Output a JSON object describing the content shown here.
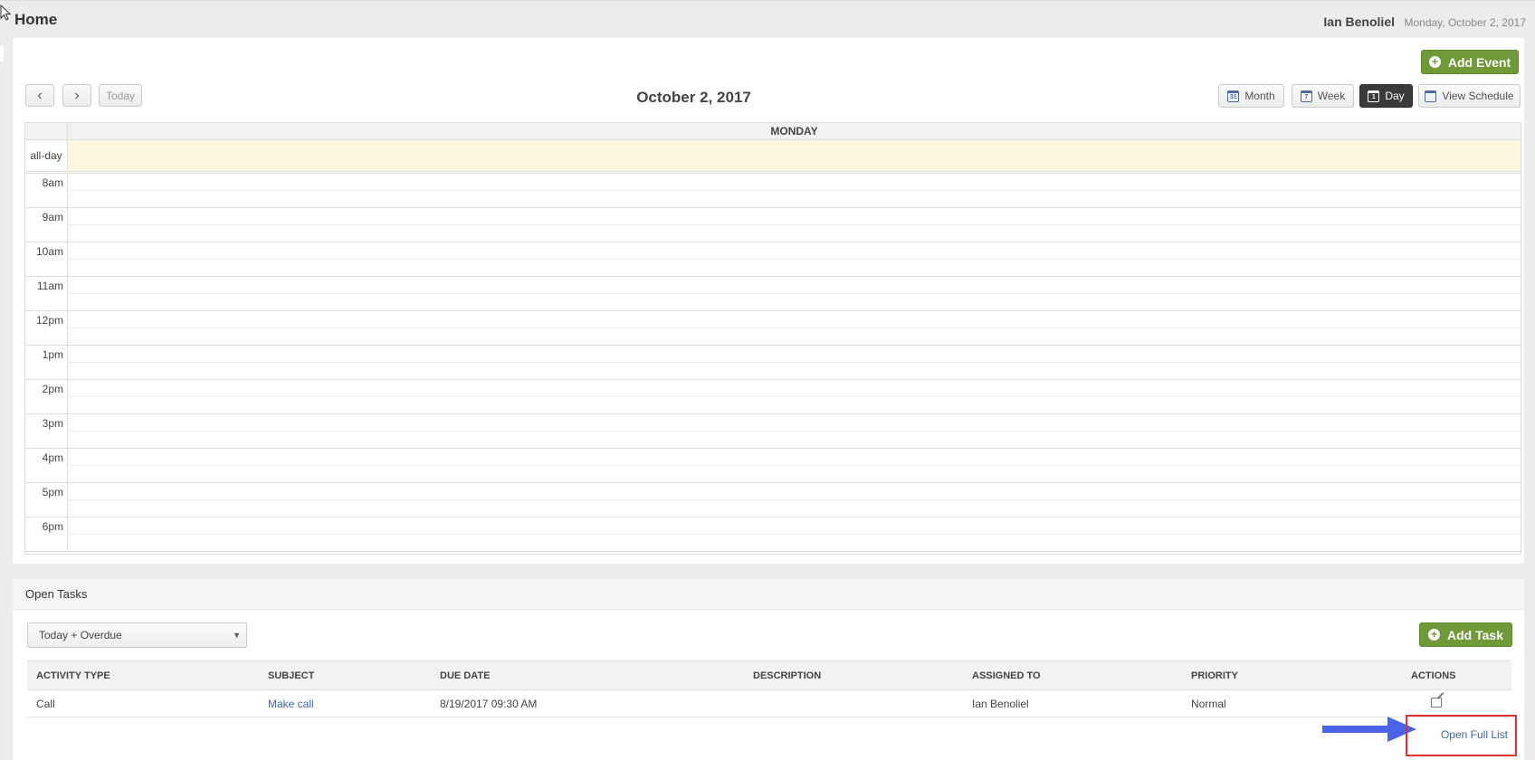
{
  "header": {
    "title": "Home",
    "user_name": "Ian Benoliel",
    "date": "Monday, October 2, 2017"
  },
  "calendar": {
    "add_event_label": "Add Event",
    "prev_symbol": "‹",
    "next_symbol": "›",
    "today_label": "Today",
    "current_date": "October 2, 2017",
    "views": [
      {
        "label": "Month",
        "icon_num": "31",
        "active": false
      },
      {
        "label": "Week",
        "icon_num": "7",
        "active": false
      },
      {
        "label": "Day",
        "icon_num": "1",
        "active": true
      },
      {
        "label": "View Schedule",
        "icon_num": "",
        "active": false
      }
    ],
    "day_header": "MONDAY",
    "allday_label": "all-day",
    "hours": [
      "8am",
      "9am",
      "10am",
      "11am",
      "12pm",
      "1pm",
      "2pm",
      "3pm",
      "4pm",
      "5pm",
      "6pm"
    ]
  },
  "tasks": {
    "title": "Open Tasks",
    "filter_value": "Today + Overdue",
    "add_task_label": "Add Task",
    "columns": [
      "ACTIVITY TYPE",
      "SUBJECT",
      "DUE DATE",
      "DESCRIPTION",
      "ASSIGNED TO",
      "PRIORITY",
      "ACTIONS"
    ],
    "rows": [
      {
        "activity_type": "Call",
        "subject": "Make call",
        "due_date": "8/19/2017 09:30 AM",
        "description": "",
        "assigned_to": "Ian Benoliel",
        "priority": "Normal"
      }
    ],
    "open_full_list_label": "Open Full List"
  },
  "colors": {
    "accent_green": "#6f9a37",
    "link_blue": "#3a6aa3",
    "highlight_red": "#e03030",
    "arrow_blue": "#4a63e8",
    "allday_bg": "#fdf6e1"
  },
  "icons": {
    "add": "plus-circle-icon",
    "calendar": "calendar-icon",
    "edit": "edit-icon",
    "annotation": "arrow-right-icon"
  }
}
